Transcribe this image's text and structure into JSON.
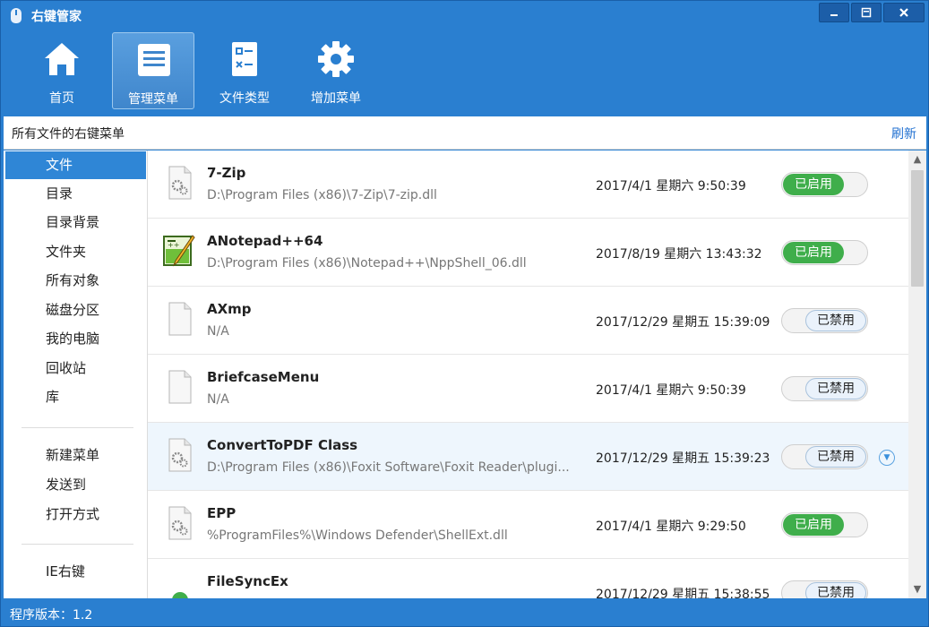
{
  "window": {
    "title": "右键管家",
    "controls": [
      "minimize",
      "restore",
      "close"
    ]
  },
  "toolbar": {
    "items": [
      {
        "label": "首页",
        "icon": "home-icon",
        "active": false
      },
      {
        "label": "管理菜单",
        "icon": "menu-list-icon",
        "active": true
      },
      {
        "label": "文件类型",
        "icon": "file-type-icon",
        "active": false
      },
      {
        "label": "增加菜单",
        "icon": "gear-icon",
        "active": false
      }
    ]
  },
  "header": {
    "title": "所有文件的右键菜单",
    "refresh_label": "刷新"
  },
  "sidebar": {
    "group1": [
      "文件",
      "目录",
      "目录背景",
      "文件夹",
      "所有对象",
      "磁盘分区",
      "我的电脑",
      "回收站",
      "库"
    ],
    "group2": [
      "新建菜单",
      "发送到",
      "打开方式"
    ],
    "group3": [
      "IE右键"
    ],
    "selected": "文件"
  },
  "list": {
    "items": [
      {
        "name": "7-Zip",
        "path": "D:\\Program Files (x86)\\7-Zip\\7-zip.dll",
        "date": "2017/4/1 星期六 9:50:39",
        "status": "已启用",
        "enabled": true,
        "icon": "dll-gear-icon"
      },
      {
        "name": "ANotepad++64",
        "path": "D:\\Program Files (x86)\\Notepad++\\NppShell_06.dll",
        "date": "2017/8/19 星期六 13:43:32",
        "status": "已启用",
        "enabled": true,
        "icon": "notepad-icon"
      },
      {
        "name": "AXmp",
        "path": "N/A",
        "date": "2017/12/29 星期五 15:39:09",
        "status": "已禁用",
        "enabled": false,
        "icon": "blank-file-icon"
      },
      {
        "name": "BriefcaseMenu",
        "path": "N/A",
        "date": "2017/4/1 星期六 9:50:39",
        "status": "已禁用",
        "enabled": false,
        "icon": "blank-file-icon"
      },
      {
        "name": "ConvertToPDF Class",
        "path": "D:\\Program Files (x86)\\Foxit Software\\Foxit Reader\\plugi...",
        "date": "2017/12/29 星期五 15:39:23",
        "status": "已禁用",
        "enabled": false,
        "icon": "dll-gear-icon",
        "highlighted": true
      },
      {
        "name": "EPP",
        "path": "%ProgramFiles%\\Windows Defender\\ShellExt.dll",
        "date": "2017/4/1 星期六 9:29:50",
        "status": "已启用",
        "enabled": true,
        "icon": "dll-gear-icon"
      },
      {
        "name": "FileSyncEx",
        "path": "",
        "date": "2017/12/29 星期五 15:38:55",
        "status": "已禁用",
        "enabled": false,
        "icon": "green-circle-icon"
      }
    ]
  },
  "statusbar": {
    "version": "程序版本：1.2"
  },
  "colors": {
    "frame": "#2a7fd0",
    "selection": "#2f86d6",
    "enabled_green": "#3fae4b",
    "link_blue": "#1f6fd0"
  }
}
